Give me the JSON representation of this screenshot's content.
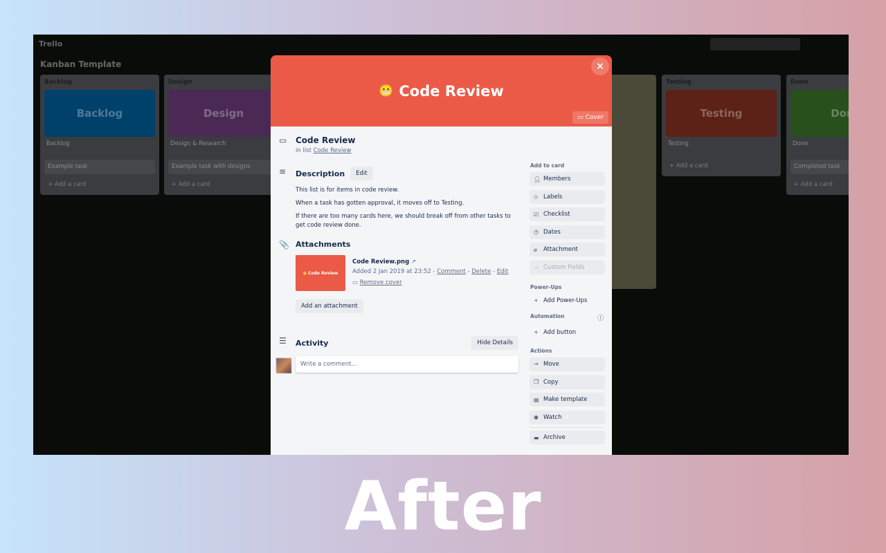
{
  "board": {
    "app_name": "Trello",
    "title": "Kanban Template",
    "lists": [
      {
        "title": "Backlog",
        "cover": "Backlog",
        "color": "#0079bf",
        "cards": [
          "Backlog",
          "Example task"
        ],
        "add": "Add a card"
      },
      {
        "title": "Design",
        "cover": "Design",
        "color": "#89609e",
        "cards": [
          "Design & Research",
          "Example task with designs"
        ],
        "add": "Add a card"
      },
      {
        "title": "Testing",
        "cover": "Testing",
        "color": "#b04632",
        "cards": [
          "Testing"
        ],
        "add": "Add a card"
      },
      {
        "title": "Done",
        "cover": "Done",
        "color": "#519839",
        "cards": [
          "Done",
          "Completed task"
        ],
        "add": "Add a card"
      }
    ]
  },
  "modal": {
    "cover_title": "Code Review",
    "cover_emoji": "😬",
    "cover_color": "#eb5a46",
    "cover_button": "Cover",
    "close": "×",
    "title": "Code Review",
    "in_list_prefix": "in list",
    "list_name": "Code Review",
    "description": {
      "heading": "Description",
      "edit": "Edit",
      "paragraphs": [
        "This list is for items in code review.",
        "When a task has gotten approval, it moves off to Testing.",
        "If there are too many cards here, we should break off from other tasks to get code review done."
      ]
    },
    "attachments": {
      "heading": "Attachments",
      "thumb_label": "Code Review",
      "file_name": "Code Review.png",
      "added": "Added 2 Jan 2019 at 23:52 -",
      "comment": "Comment",
      "delete": "Delete",
      "edit": "Edit",
      "remove_cover": "Remove cover",
      "add": "Add an attachment"
    },
    "activity": {
      "heading": "Activity",
      "hide_details": "Hide Details",
      "comment_placeholder": "Write a comment..."
    },
    "sidebar": {
      "add_to_card": "Add to card",
      "add_items": [
        "Members",
        "Labels",
        "Checklist",
        "Dates",
        "Attachment",
        "Custom Fields"
      ],
      "power_ups": "Power-Ups",
      "add_power_ups": "Add Power-Ups",
      "automation": "Automation",
      "add_button": "Add button",
      "actions": "Actions",
      "action_items": [
        "Move",
        "Copy",
        "Make template",
        "Watch",
        "Archive"
      ]
    }
  },
  "caption": "After"
}
